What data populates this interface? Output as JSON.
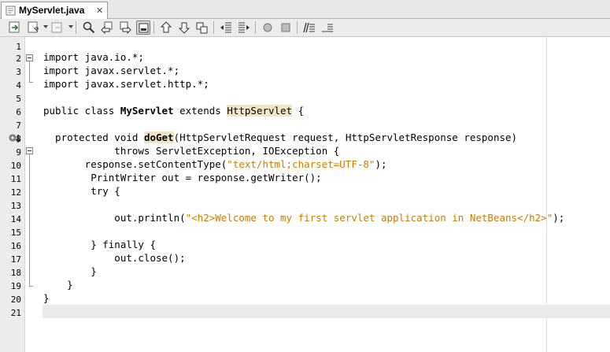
{
  "tab": {
    "title": "MyServlet.java",
    "close": "✕"
  },
  "toolbar": {
    "buttons": [
      "back-to-last-edit",
      "history",
      "forward",
      "find",
      "find-previous",
      "find-next",
      "toggle-highlight",
      "previous-bookmark",
      "next-bookmark",
      "toggle-bookmark",
      "shift-left",
      "shift-right",
      "start-macro",
      "stop-macro",
      "comment",
      "uncomment"
    ]
  },
  "lines": {
    "1": "1",
    "2": "2",
    "3": "3",
    "4": "4",
    "5": "5",
    "6": "6",
    "7": "7",
    "8": "8",
    "9": "9",
    "10": "10",
    "11": "11",
    "12": "12",
    "13": "13",
    "14": "14",
    "15": "15",
    "16": "16",
    "17": "17",
    "18": "18",
    "19": "19",
    "20": "20",
    "21": "21"
  },
  "code": {
    "l2": "import java.io.*;",
    "l3": "import javax.servlet.*;",
    "l4": "import javax.servlet.http.*;",
    "l6a": "public class ",
    "l6b": "MyServlet",
    "l6c": " extends ",
    "l6d": "HttpServlet",
    "l6e": " {",
    "l8a": "  protected void ",
    "l8b": "doGet",
    "l8c": "(HttpServletRequest request, HttpServletResponse response)",
    "l9": "            throws ServletException, IOException {",
    "l10a": "       response.setContentType(",
    "l10b": "\"text/html;charset=UTF-8\"",
    "l10c": ");",
    "l11": "        PrintWriter out = response.getWriter();",
    "l12": "        try {",
    "l14a": "            out.println(",
    "l14b": "\"<h2>Welcome to my first servlet application in NetBeans</h2>\"",
    "l14c": ");",
    "l16": "        } finally {",
    "l17": "            out.close();",
    "l18": "        }",
    "l19": "    }",
    "l20": "}"
  },
  "colors": {
    "string": "#ce7b00",
    "highlight": "#f2e6c2",
    "current_line": "#eaeaea"
  }
}
